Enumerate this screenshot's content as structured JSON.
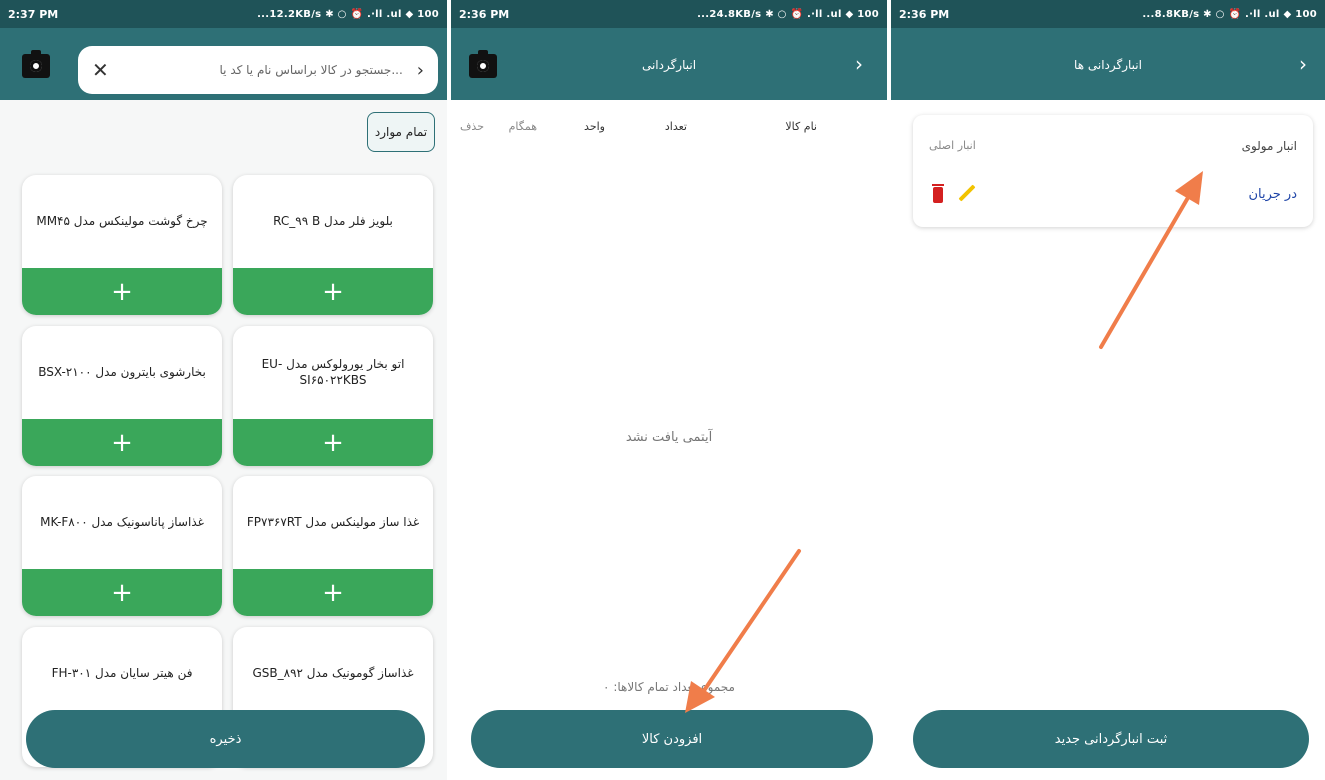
{
  "panel1": {
    "status": {
      "time": "2:37 PM",
      "right": "...12.2KB/s ✱ ○ ⏰ .∙ll .ul ◆ 100"
    },
    "search_placeholder": "...جستجو در کالا براساس نام یا کد یا",
    "chip_label": "تمام موارد",
    "products": [
      "چرخ گوشت مولینکس مدل MM۴۵",
      "بلویز فلر مدل RC_۹۹ B",
      "بخارشوی بایترون مدل BSX-۲۱۰۰",
      "اتو بخار یورولوکس مدل EU-SI۶۵۰۲۲KBS",
      "غذاساز پاناسونیک مدل MK-F۸۰۰",
      "غذا ساز مولینکس مدل FP۷۳۶۷RT",
      "فن هیتر سایان مدل FH-۳۰۱",
      "غذاساز گومونیک مدل GSB_۸۹۲"
    ],
    "add_symbol": "+",
    "save_label": "ذخیره"
  },
  "panel2": {
    "status": {
      "time": "2:36 PM",
      "right": "...24.8KB/s ✱ ○ ⏰ .∙ll .ul ◆ 100"
    },
    "title": "انبارگردانی",
    "columns": [
      "نام کالا",
      "تعداد",
      "واحد",
      "همگام",
      "حذف"
    ],
    "empty_text": "آیتمی یافت نشد",
    "total_text": "مجموع تعداد تمام کالاها: ۰",
    "add_label": "افزودن کالا"
  },
  "panel3": {
    "status": {
      "time": "2:36 PM",
      "right": "...8.8KB/s ✱ ○ ⏰ .∙ll .ul ◆ 100"
    },
    "title": "انبارگردانی ها",
    "warehouse": "انبار مولوی",
    "sub": "انبار اصلی",
    "state": "در جریان",
    "new_label": "ثبت انبارگردانی جدید"
  },
  "colors": {
    "primary": "#2e7076",
    "status_bar": "#1f5358",
    "add_green": "#3aa75a",
    "arrow": "#f07d4a",
    "link_blue": "#2046a8",
    "delete_red": "#d42020"
  }
}
